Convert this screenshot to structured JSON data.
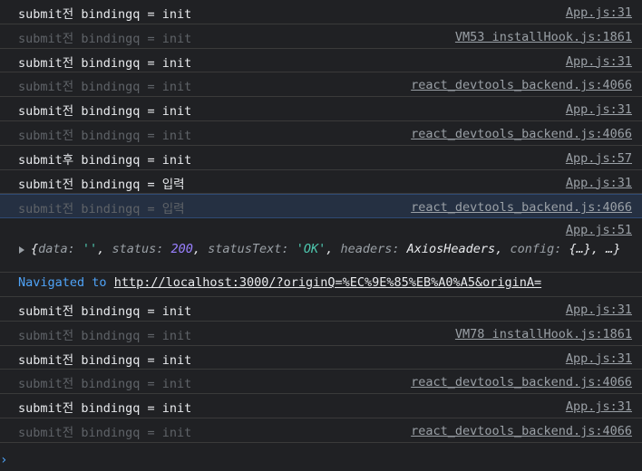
{
  "logs": [
    {
      "text": "submit전 bindingq = init",
      "source": "App.js:31",
      "dim": false
    },
    {
      "text": "submit전 bindingq = init",
      "source": "VM53 installHook.js:1861",
      "dim": true
    },
    {
      "text": "submit전 bindingq = init",
      "source": "App.js:31",
      "dim": false
    },
    {
      "text": "submit전 bindingq = init",
      "source": "react_devtools_backend.js:4066",
      "dim": true
    },
    {
      "text": "submit전 bindingq = init",
      "source": "App.js:31",
      "dim": false
    },
    {
      "text": "submit전 bindingq = init",
      "source": "react_devtools_backend.js:4066",
      "dim": true
    },
    {
      "text": "submit후 bindingq = init",
      "source": "App.js:57",
      "dim": false
    },
    {
      "text": "submit전 bindingq = 입력",
      "source": "App.js:31",
      "dim": false
    },
    {
      "text": "submit전 bindingq = 입력",
      "source": "react_devtools_backend.js:4066",
      "dim": true,
      "selected": true
    }
  ],
  "object_log": {
    "source": "App.js:51",
    "data_key": "data:",
    "data_val": "''",
    "status_key": "status:",
    "status_val": "200",
    "statusText_key": "statusText:",
    "statusText_val": "'OK'",
    "headers_key": "headers:",
    "headers_val": "AxiosHeaders",
    "config_key": "config:",
    "config_val": "{…}",
    "ellipsis": "…"
  },
  "navigation": {
    "label": "Navigated to",
    "url": "http://localhost:3000/?originQ=%EC%9E%85%EB%A0%A5&originA="
  },
  "logs_after": [
    {
      "text": "submit전 bindingq = init",
      "source": "App.js:31",
      "dim": false
    },
    {
      "text": "submit전 bindingq = init",
      "source": "VM78 installHook.js:1861",
      "dim": true
    },
    {
      "text": "submit전 bindingq = init",
      "source": "App.js:31",
      "dim": false
    },
    {
      "text": "submit전 bindingq = init",
      "source": "react_devtools_backend.js:4066",
      "dim": true
    },
    {
      "text": "submit전 bindingq = init",
      "source": "App.js:31",
      "dim": false
    },
    {
      "text": "submit전 bindingq = init",
      "source": "react_devtools_backend.js:4066",
      "dim": true
    }
  ],
  "prompt_symbol": "›",
  "colors": {
    "background": "#202124",
    "link": "#4fa3f7",
    "dim_text": "#5f6368"
  }
}
